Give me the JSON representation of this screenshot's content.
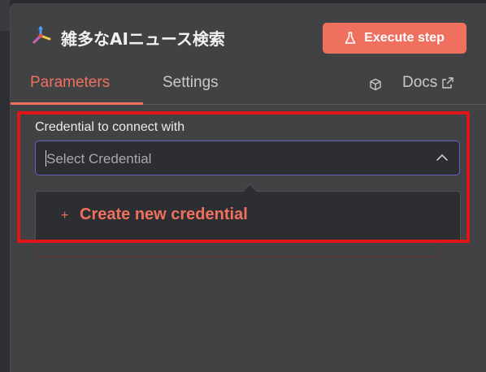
{
  "node": {
    "title": "雑多なAIニュース検索",
    "icon": "node-type-icon"
  },
  "header": {
    "execute_label": "Execute step"
  },
  "tabs": [
    {
      "label": "Parameters",
      "active": true
    },
    {
      "label": "Settings",
      "active": false
    }
  ],
  "docs": {
    "label": "Docs"
  },
  "credential": {
    "label": "Credential to connect with",
    "placeholder": "Select Credential"
  },
  "dropdown": {
    "create_label": "Create new credential"
  },
  "colors": {
    "accent": "#f0705f",
    "panel": "#414244",
    "input_bg": "#2d2e31",
    "focus_border": "#6a5fc9",
    "highlight_box": "#e0151a"
  }
}
